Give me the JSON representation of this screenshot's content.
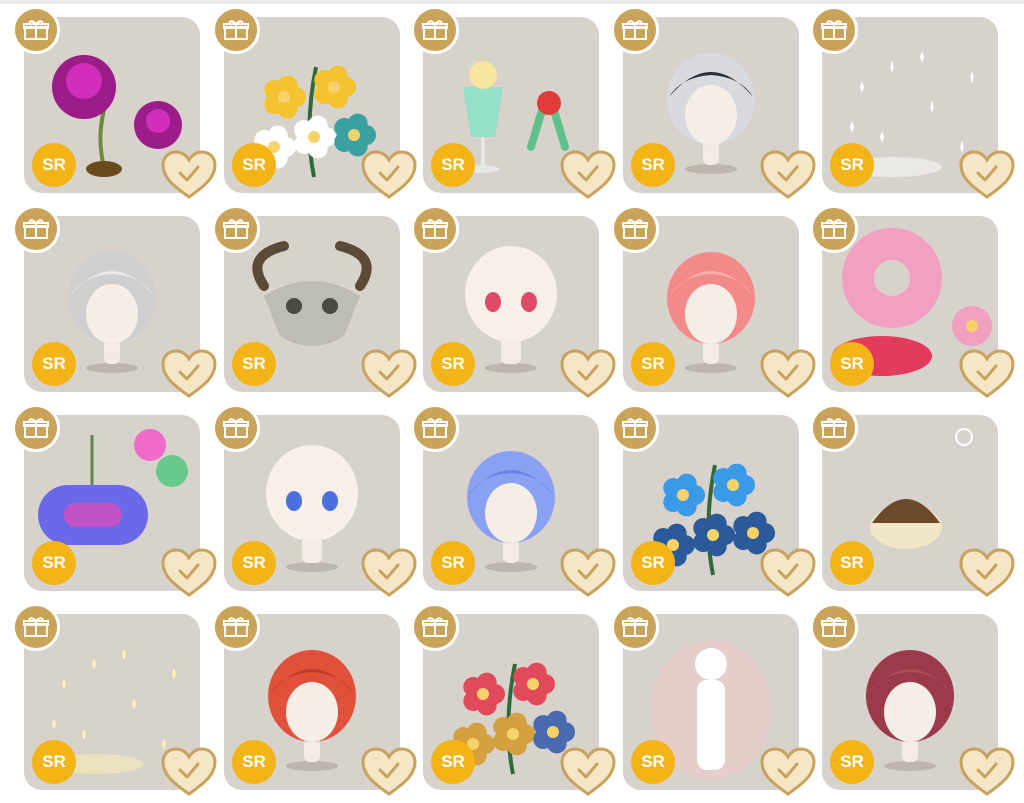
{
  "rarity_label": "SR",
  "colors": {
    "tile_bg": "#d7d2cb",
    "gift_badge": "#c9a35a",
    "rarity_badge": "#f3b417",
    "heart_fill": "#f5e6c8",
    "heart_stroke": "#c7a35e"
  },
  "items": [
    {
      "name": "purple-rose-lamp",
      "rarity": "SR",
      "icon": "rose",
      "palette": [
        "#9c1c8a",
        "#d12fb9",
        "#6b4a1e"
      ]
    },
    {
      "name": "sunflower-bouquet",
      "rarity": "SR",
      "icon": "flowers",
      "palette": [
        "#f4c430",
        "#ffffff",
        "#3aa0a0"
      ]
    },
    {
      "name": "cream-soda-bow",
      "rarity": "SR",
      "icon": "soda",
      "palette": [
        "#8fe0c8",
        "#e23b3b",
        "#5fc08a"
      ]
    },
    {
      "name": "silver-hair",
      "rarity": "SR",
      "icon": "hair",
      "palette": [
        "#d9d9e0",
        "#2c2f3a"
      ]
    },
    {
      "name": "sparkle-effect",
      "rarity": "SR",
      "icon": "sparkle",
      "palette": [
        "#ffffff"
      ]
    },
    {
      "name": "grey-braided-hair",
      "rarity": "SR",
      "icon": "hair",
      "palette": [
        "#cfcfcf",
        "#e8e8e8"
      ]
    },
    {
      "name": "bull-skull",
      "rarity": "SR",
      "icon": "skull",
      "palette": [
        "#bdbdb5",
        "#5a4a36"
      ]
    },
    {
      "name": "red-eyes-face",
      "rarity": "SR",
      "icon": "face",
      "palette": [
        "#e04a6a"
      ]
    },
    {
      "name": "pink-wavy-hair",
      "rarity": "SR",
      "icon": "hair",
      "palette": [
        "#f28a8a",
        "#f6b0a6"
      ]
    },
    {
      "name": "livly-donuts",
      "rarity": "SR",
      "icon": "donut",
      "palette": [
        "#f2a0c0",
        "#e23b5b",
        "#f6d36a"
      ]
    },
    {
      "name": "gamer-controller",
      "rarity": "SR",
      "icon": "controller",
      "palette": [
        "#6a6ae8",
        "#e84ab8",
        "#40d0e8"
      ]
    },
    {
      "name": "blue-eyes-face",
      "rarity": "SR",
      "icon": "face",
      "palette": [
        "#4a70e0"
      ]
    },
    {
      "name": "blue-starry-hair",
      "rarity": "SR",
      "icon": "hair",
      "palette": [
        "#8aa0f0",
        "#6a80e8"
      ]
    },
    {
      "name": "blue-anemone",
      "rarity": "SR",
      "icon": "flowers",
      "palette": [
        "#3a9ae8",
        "#2a5a9a"
      ]
    },
    {
      "name": "hedgehog-pancake",
      "rarity": "SR",
      "icon": "creature",
      "palette": [
        "#6a4a2a",
        "#f0e6c8"
      ]
    },
    {
      "name": "golden-sparkle-effect",
      "rarity": "SR",
      "icon": "sparkle",
      "palette": [
        "#fff2b0"
      ]
    },
    {
      "name": "red-curly-hair",
      "rarity": "SR",
      "icon": "hair",
      "palette": [
        "#e0503a",
        "#c03a2a"
      ]
    },
    {
      "name": "red-golden-flowers",
      "rarity": "SR",
      "icon": "flowers",
      "palette": [
        "#e04a5a",
        "#d4a040",
        "#4a6ab0"
      ]
    },
    {
      "name": "pink-aura-mannequin",
      "rarity": "SR",
      "icon": "aura",
      "palette": [
        "#f6c8c8",
        "#ffffff"
      ]
    },
    {
      "name": "burgundy-long-hair",
      "rarity": "SR",
      "icon": "hair",
      "palette": [
        "#9a3a4a",
        "#b04a5a"
      ]
    }
  ]
}
